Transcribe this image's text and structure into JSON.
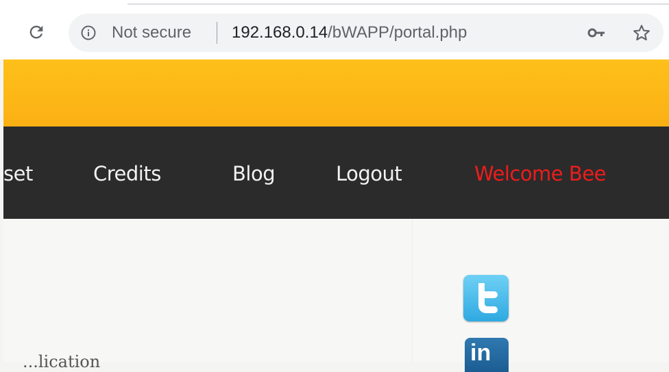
{
  "browser": {
    "security_label": "Not secure",
    "url_host": "192.168.0.14",
    "url_path": "/bWAPP/portal.php",
    "icons": [
      "reload-icon",
      "info-icon",
      "key-icon",
      "star-icon"
    ]
  },
  "nav": {
    "items": [
      {
        "label": "set"
      },
      {
        "label": "Credits"
      },
      {
        "label": "Blog"
      },
      {
        "label": "Logout"
      }
    ],
    "welcome": "Welcome Bee"
  },
  "social": {
    "linkedin_text": "in"
  },
  "content": {
    "partial_text": "...lication"
  },
  "colors": {
    "banner": "#fbb014",
    "nav_bg": "#2b2b2b",
    "welcome": "#ee1c1c",
    "twitter": "#2fa9e1",
    "linkedin": "#1b5d92"
  }
}
